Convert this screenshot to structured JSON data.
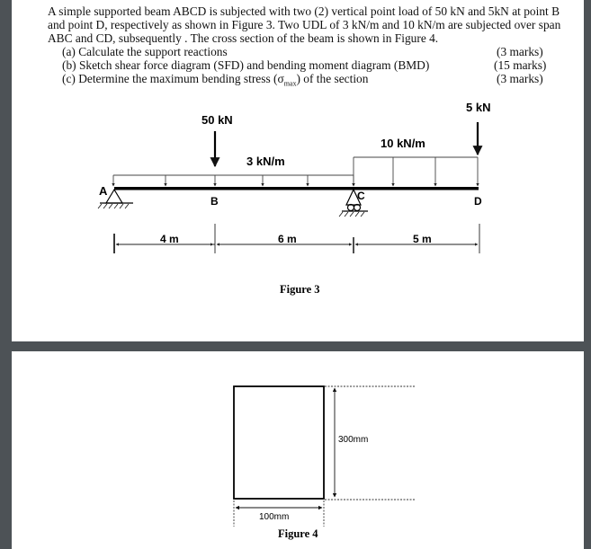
{
  "question": {
    "lines": [
      "A simple supported beam ABCD is subjected with two (2) vertical point load of 50 kN and  5kN at point B",
      "and point D, respectively as shown in Figure 3. Two UDL of 3 kN/m and 10 kN/m  are subjected over span",
      "ABC and CD, subsequently . The cross section of the beam is shown in Figure 4."
    ],
    "parts": [
      {
        "text": "(a) Calculate the support reactions",
        "marks": "(3 marks)"
      },
      {
        "text": "(b) Sketch shear force diagram (SFD) and bending moment diagram (BMD)",
        "marks": "(15 marks)"
      },
      {
        "text_before": "(c) Determine the maximum bending stress (σ",
        "subscript": "max",
        "text_after": ") of the section",
        "marks": "(3 marks)"
      }
    ]
  },
  "figure3": {
    "caption": "Figure 3",
    "point_loads": [
      {
        "label": "50 kN",
        "at": "B"
      },
      {
        "label": "5 kN",
        "at": "D"
      }
    ],
    "udls": [
      {
        "label": "3 kN/m",
        "span": "ABC"
      },
      {
        "label": "10 kN/m",
        "span": "CD"
      }
    ],
    "points": {
      "A": "A",
      "B": "B",
      "C": "C",
      "D": "D"
    },
    "spans": [
      {
        "label": "4 m"
      },
      {
        "label": "6 m"
      },
      {
        "label": "5 m"
      }
    ]
  },
  "figure4": {
    "caption": "Figure 4",
    "height_label": "300mm",
    "width_label": "100mm"
  }
}
